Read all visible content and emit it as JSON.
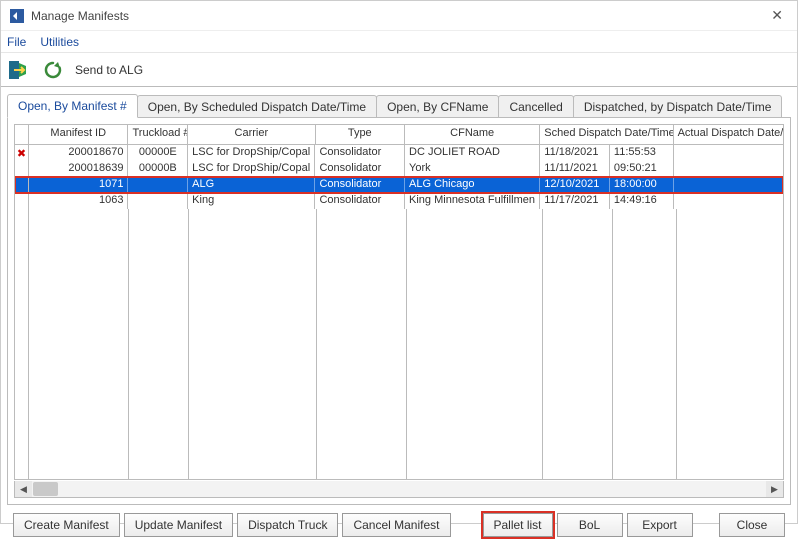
{
  "window": {
    "title": "Manage Manifests"
  },
  "menu": {
    "file": "File",
    "utilities": "Utilities"
  },
  "toolbar": {
    "send_label": "Send to ALG"
  },
  "tabs": {
    "t0": "Open, By Manifest #",
    "t1": "Open, By Scheduled Dispatch Date/Time",
    "t2": "Open, By CFName",
    "t3": "Cancelled",
    "t4": "Dispatched, by Dispatch Date/Time"
  },
  "columns": {
    "c0": "Manifest ID",
    "c1": "Truckload #",
    "c2": "Carrier",
    "c3": "Type",
    "c4": "CFName",
    "c5": "Sched Dispatch Date/Time",
    "c6": "Actual Dispatch Date/Tim"
  },
  "rows": [
    {
      "indicator": "✖",
      "id": "200018670",
      "truck": "00000E",
      "carrier": "LSC  for DropShip/Copal",
      "type": "Consolidator",
      "cf": "DC JOLIET ROAD",
      "d1": "11/18/2021",
      "d2": "11:55:53"
    },
    {
      "indicator": "",
      "id": "200018639",
      "truck": "00000B",
      "carrier": "LSC  for DropShip/Copal",
      "type": "Consolidator",
      "cf": "York",
      "d1": "11/11/2021",
      "d2": "09:50:21"
    },
    {
      "indicator": "",
      "id": "1071",
      "truck": "",
      "carrier": "ALG",
      "type": "Consolidator",
      "cf": "ALG Chicago",
      "d1": "12/10/2021",
      "d2": "18:00:00"
    },
    {
      "indicator": "",
      "id": "1063",
      "truck": "",
      "carrier": "King",
      "type": "Consolidator",
      "cf": "King Minnesota Fulfillmen",
      "d1": "11/17/2021",
      "d2": "14:49:16"
    }
  ],
  "buttons": {
    "create": "Create Manifest",
    "update": "Update Manifest",
    "dispatch": "Dispatch Truck",
    "cancel": "Cancel Manifest",
    "pallet": "Pallet list",
    "bol": "BoL",
    "export": "Export",
    "close": "Close"
  },
  "layout": {
    "colw": {
      "ind": 14,
      "c0": 100,
      "c1": 60,
      "c2": 128,
      "c3": 90,
      "c4": 136,
      "c5a": 70,
      "c5b": 64,
      "c6": 110
    }
  }
}
